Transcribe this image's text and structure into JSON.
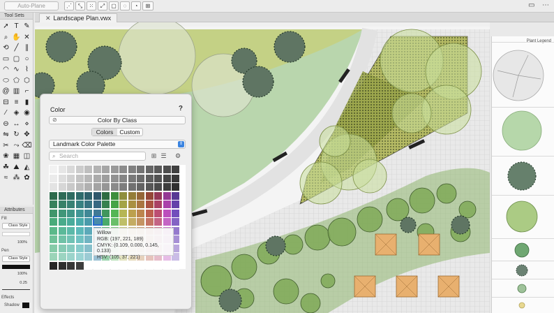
{
  "toolbar": {
    "snap_field": "Auto-Plane"
  },
  "tool_sets": {
    "title": "Tool Sets",
    "tools": [
      "pointer-icon",
      "text-icon",
      "callout-icon",
      "zoom-icon",
      "pan-icon",
      "locus-icon",
      "flyover-icon",
      "line-icon",
      "double-line-icon",
      "rectangle-icon",
      "rounded-rect-icon",
      "circle-icon",
      "arc-icon",
      "freehand-icon",
      "polyline-icon",
      "oval-icon",
      "polygon-icon",
      "regular-polygon-icon",
      "spiral-icon",
      "wall-icon",
      "door-icon",
      "window-icon",
      "stair-icon",
      "column-icon",
      "eyedropper-icon",
      "attribute-icon",
      "camera-icon",
      "section-icon",
      "dimension-icon",
      "reshape-icon",
      "mirror-icon",
      "rotate-icon",
      "move-icon",
      "split-icon",
      "connect-icon",
      "trim-icon",
      "plant-icon",
      "hardscape-icon",
      "massing-icon",
      "landscape-area-icon",
      "site-model-icon",
      "grade-icon",
      "irrigation-icon",
      "hedge-icon",
      "tree-icon"
    ]
  },
  "attributes": {
    "title": "Attributes",
    "fill_label": "Fill",
    "fill_style": "Class Style",
    "fill_opacity": "100%",
    "pen_label": "Pen",
    "pen_style": "Class Style",
    "pen_opacity": "100%",
    "line_weight": "0.25",
    "effects_label": "Effects",
    "shadow_label": "Shadow"
  },
  "document": {
    "tab_title": "Landscape Plan.vwx"
  },
  "legend": {
    "title": "Plant Legend"
  },
  "color_popover": {
    "title": "Color",
    "help": "?",
    "color_by_class": "Color By Class",
    "tabs": [
      "Colors",
      "Custom"
    ],
    "active_tab": "Colors",
    "palette": "Landmark Color Palette",
    "search_placeholder": "Search",
    "selected": {
      "name": "Willow",
      "rgb": "RGB: (197, 221, 189)",
      "cmyk": "CMYK: (0.109, 0.000, 0.145, 0.133)",
      "hsv": "HSV: (105, 37, 221)"
    }
  },
  "colors": {
    "accent": "#3b84e0",
    "lawn": "#b9d6ad",
    "canopy_olive": "#a8b35a",
    "tree_dark": "#5f7563",
    "paving": "#e6e6e6",
    "umbrella": "#e8b06f",
    "selected_swatch": "#c5ddbd"
  }
}
